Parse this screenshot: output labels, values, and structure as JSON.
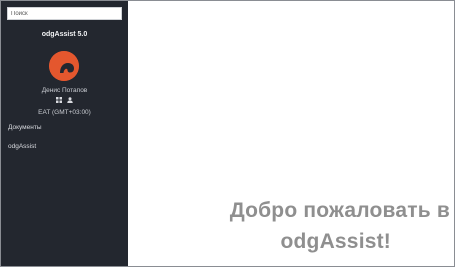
{
  "sidebar": {
    "search": {
      "placeholder": "Поиск"
    },
    "app_title": "odgAssist 5.0",
    "user": {
      "name": "Денис Потапов",
      "avatar_color": "#e4572e",
      "icons": [
        "apps-icon",
        "user-icon"
      ],
      "timezone": "EAT (GMT+03:00)"
    },
    "nav": [
      {
        "label": "Документы"
      },
      {
        "label": "odgAssist"
      }
    ]
  },
  "main": {
    "welcome_line1": "Добро пожаловать в",
    "welcome_line2": "odgAssist!"
  },
  "colors": {
    "sidebar_bg": "#23272f",
    "welcome_text": "#8f8f8f",
    "accent": "#e4572e"
  }
}
